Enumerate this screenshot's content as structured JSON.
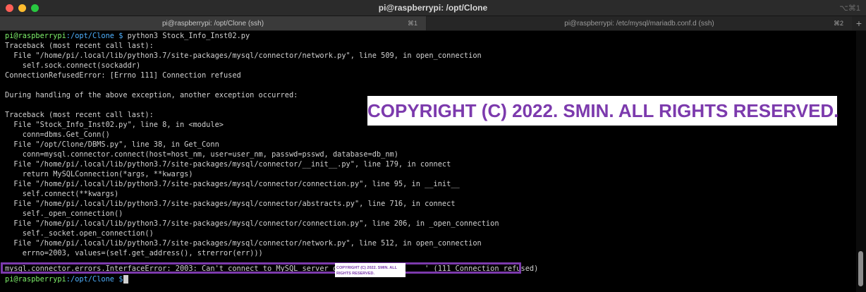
{
  "window": {
    "title": "pi@raspberrypi: /opt/Clone",
    "shortcut": "⌥⌘1"
  },
  "tabs": [
    {
      "label": "pi@raspberrypi: /opt/Clone (ssh)",
      "shortcut": "⌘1"
    },
    {
      "label": "pi@raspberrypi: /etc/mysql/mariadb.conf.d (ssh)",
      "shortcut": "⌘2"
    }
  ],
  "terminal": {
    "prompt_user": "pi@raspberrypi",
    "prompt_path": ":/opt/Clone $ ",
    "command": "python3 Stock_Info_Inst02.py",
    "lines": [
      "Traceback (most recent call last):",
      "  File \"/home/pi/.local/lib/python3.7/site-packages/mysql/connector/network.py\", line 509, in open_connection",
      "    self.sock.connect(sockaddr)",
      "ConnectionRefusedError: [Errno 111] Connection refused",
      "",
      "During handling of the above exception, another exception occurred:",
      "",
      "Traceback (most recent call last):",
      "  File \"Stock_Info_Inst02.py\", line 8, in <module>",
      "    conn=dbms.Get_Conn()",
      "  File \"/opt/Clone/DBMS.py\", line 38, in Get_Conn",
      "    conn=mysql.connector.connect(host=host_nm, user=user_nm, passwd=psswd, database=db_nm)",
      "  File \"/home/pi/.local/lib/python3.7/site-packages/mysql/connector/__init__.py\", line 179, in connect",
      "    return MySQLConnection(*args, **kwargs)",
      "  File \"/home/pi/.local/lib/python3.7/site-packages/mysql/connector/connection.py\", line 95, in __init__",
      "    self.connect(**kwargs)",
      "  File \"/home/pi/.local/lib/python3.7/site-packages/mysql/connector/abstracts.py\", line 716, in connect",
      "    self._open_connection()",
      "  File \"/home/pi/.local/lib/python3.7/site-packages/mysql/connector/connection.py\", line 206, in _open_connection",
      "    self._socket.open_connection()",
      "  File \"/home/pi/.local/lib/python3.7/site-packages/mysql/connector/network.py\", line 512, in open_connection",
      "    errno=2003, values=(self.get_address(), strerror(err)))"
    ],
    "error_line": "mysql.connector.errors.InterfaceError: 2003: Can't connect to MySQL server on '                 ' (111 Connection refused)",
    "final_prompt_user": "pi@raspberrypi",
    "final_prompt_path": ":/opt/Clone $ "
  },
  "overlays": {
    "copyright_big": "COPYRIGHT (C) 2022. SMIN. ALL RIGHTS RESERVED.",
    "copyright_small": "COPYRIGHT (C) 2022. SMIN. ALL RIGHTS RESERVED."
  }
}
